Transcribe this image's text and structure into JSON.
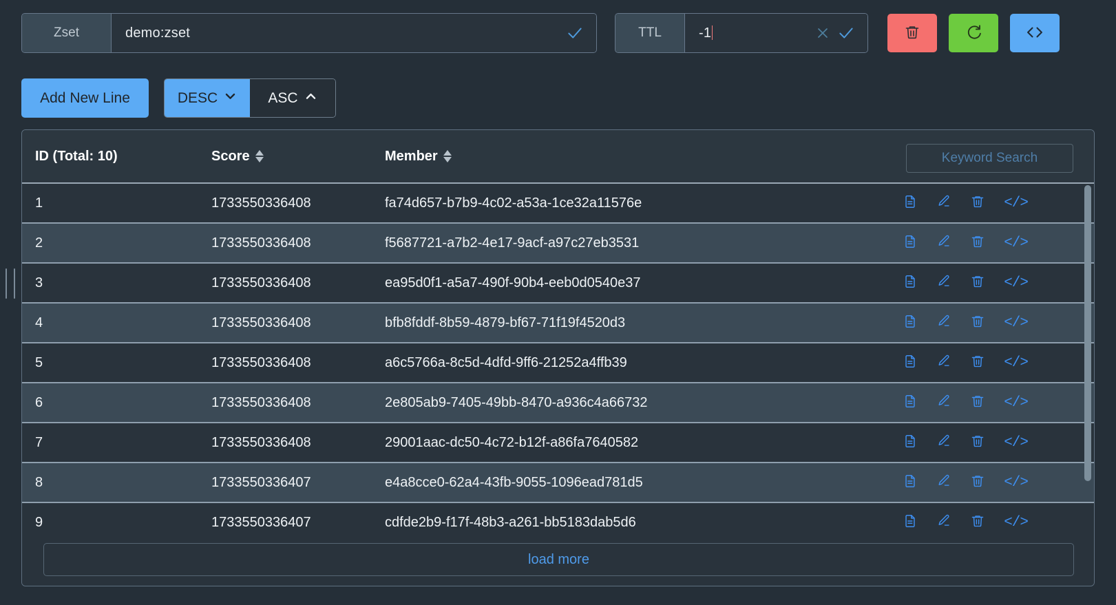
{
  "keyField": {
    "type_label": "Zset",
    "key_value": "demo:zset",
    "confirm_icon": "check-icon"
  },
  "ttlField": {
    "label": "TTL",
    "value": "-1",
    "clear_icon": "close-icon",
    "confirm_icon": "check-icon"
  },
  "actions": {
    "delete_icon": "trash-icon",
    "refresh_icon": "refresh-icon",
    "code_icon": "code-icon",
    "delete_color": "#f5706e",
    "refresh_color": "#6dcb3f",
    "code_color": "#5cabf5"
  },
  "toolbar": {
    "add_new_line": "Add New Line",
    "desc_label": "DESC",
    "asc_label": "ASC",
    "desc_icon": "chevron-down-icon",
    "asc_icon": "chevron-up-icon",
    "active_sort": "DESC"
  },
  "table": {
    "columns": {
      "id": "ID (Total: 10)",
      "score": "Score",
      "member": "Member"
    },
    "search_placeholder": "Keyword Search",
    "search_value": "",
    "total": 10,
    "row_icons": {
      "detail": "document-icon",
      "edit": "pencil-icon",
      "delete": "trash-icon",
      "code": "code-icon"
    },
    "rows": [
      {
        "id": "1",
        "score": "1733550336408",
        "member": "fa74d657-b7b9-4c02-a53a-1ce32a11576e"
      },
      {
        "id": "2",
        "score": "1733550336408",
        "member": "f5687721-a7b2-4e17-9acf-a97c27eb3531"
      },
      {
        "id": "3",
        "score": "1733550336408",
        "member": "ea95d0f1-a5a7-490f-90b4-eeb0d0540e37"
      },
      {
        "id": "4",
        "score": "1733550336408",
        "member": "bfb8fddf-8b59-4879-bf67-71f19f4520d3"
      },
      {
        "id": "5",
        "score": "1733550336408",
        "member": "a6c5766a-8c5d-4dfd-9ff6-21252a4ffb39"
      },
      {
        "id": "6",
        "score": "1733550336408",
        "member": "2e805ab9-7405-49bb-8470-a936c4a66732"
      },
      {
        "id": "7",
        "score": "1733550336408",
        "member": "29001aac-dc50-4c72-b12f-a86fa7640582"
      },
      {
        "id": "8",
        "score": "1733550336407",
        "member": "e4a8cce0-62a4-43fb-9055-1096ead781d5"
      },
      {
        "id": "9",
        "score": "1733550336407",
        "member": "cdfde2b9-f17f-48b3-a261-bb5183dab5d6"
      }
    ],
    "load_more": "load more"
  }
}
